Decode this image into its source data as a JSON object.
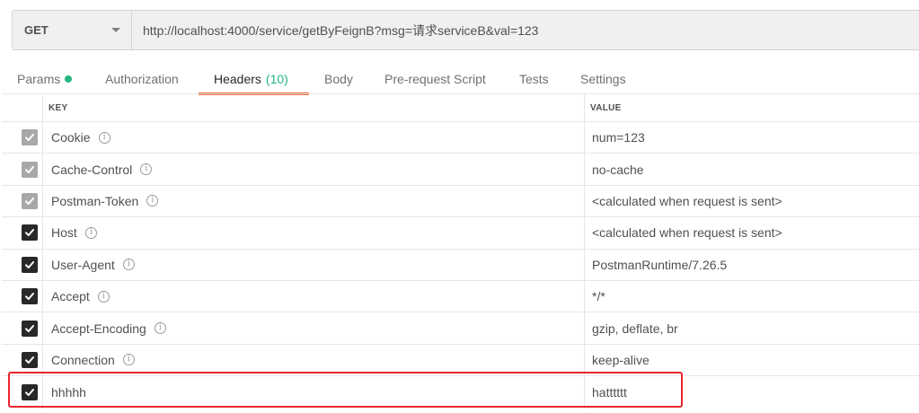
{
  "request": {
    "method": "GET",
    "url": "http://localhost:4000/service/getByFeignB?msg=请求serviceB&val=123"
  },
  "tabs": [
    {
      "label": "Params",
      "has_dot": true
    },
    {
      "label": "Authorization"
    },
    {
      "label": "Headers",
      "count": "(10)",
      "active": true
    },
    {
      "label": "Body"
    },
    {
      "label": "Pre-request Script"
    },
    {
      "label": "Tests"
    },
    {
      "label": "Settings"
    }
  ],
  "table": {
    "columns": {
      "key": "KEY",
      "value": "VALUE"
    },
    "rows": [
      {
        "key": "Cookie",
        "value": "num=123",
        "checked": true,
        "auto": true,
        "info": true
      },
      {
        "key": "Cache-Control",
        "value": "no-cache",
        "checked": true,
        "auto": true,
        "info": true
      },
      {
        "key": "Postman-Token",
        "value": "<calculated when request is sent>",
        "checked": true,
        "auto": true,
        "info": true
      },
      {
        "key": "Host",
        "value": "<calculated when request is sent>",
        "checked": true,
        "auto": false,
        "info": true
      },
      {
        "key": "User-Agent",
        "value": "PostmanRuntime/7.26.5",
        "checked": true,
        "auto": false,
        "info": true
      },
      {
        "key": "Accept",
        "value": "*/*",
        "checked": true,
        "auto": false,
        "info": true
      },
      {
        "key": "Accept-Encoding",
        "value": "gzip, deflate, br",
        "checked": true,
        "auto": false,
        "info": true
      },
      {
        "key": "Connection",
        "value": "keep-alive",
        "checked": true,
        "auto": false,
        "info": true
      },
      {
        "key": "hhhhh",
        "value": "hatttttt",
        "checked": true,
        "auto": false,
        "info": false,
        "highlighted": true
      }
    ]
  },
  "icons": {
    "info": "info-circle-icon",
    "checkbox": "checkmark-icon",
    "method_dropdown": "chevron-down-icon"
  },
  "colors": {
    "accent_green": "#26b47f",
    "active_tab_underline": "#f26b3a",
    "highlight_border": "#e8262a"
  }
}
